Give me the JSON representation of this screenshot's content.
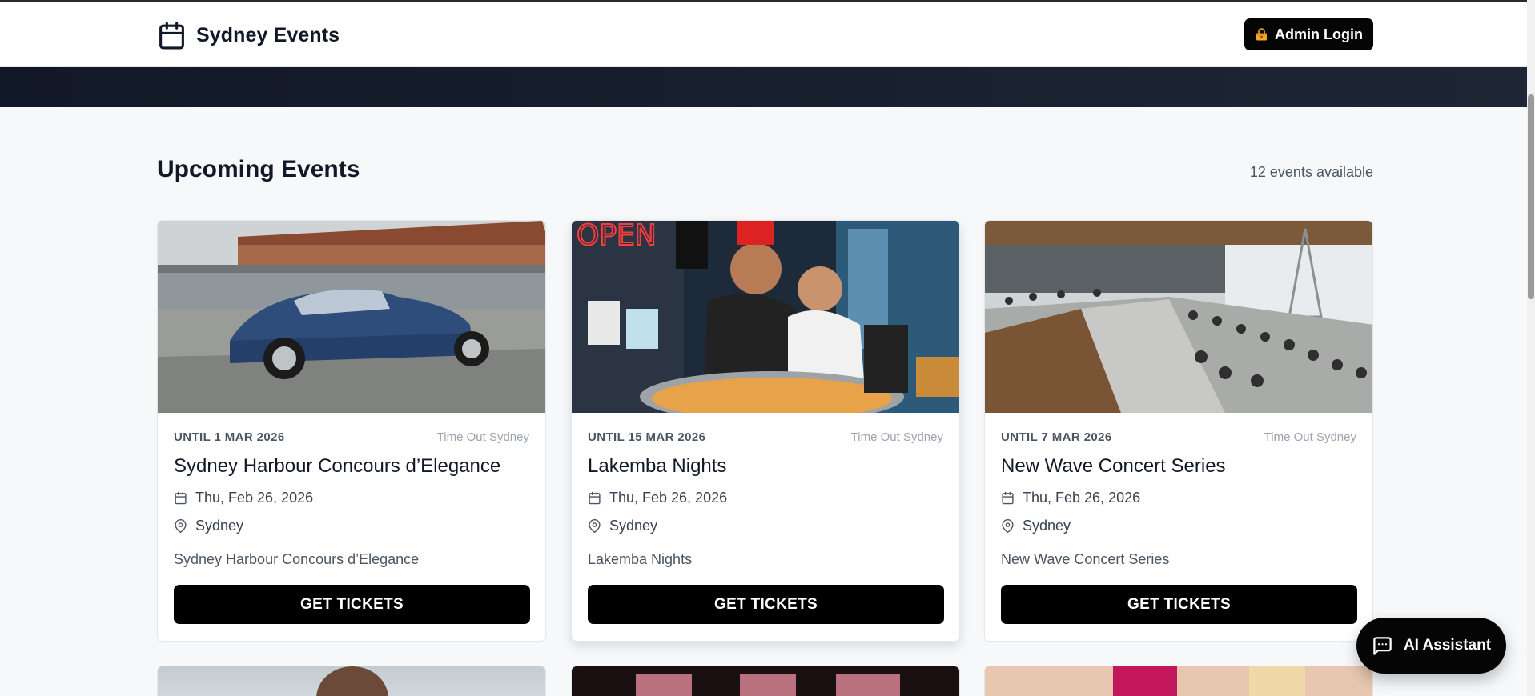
{
  "header": {
    "brand_name": "Sydney Events",
    "brand_icon": "calendar-icon",
    "admin_label": "Admin Login",
    "admin_icon": "lock-icon"
  },
  "section": {
    "title": "Upcoming Events",
    "count_text": "12 events available"
  },
  "events": [
    {
      "until": "UNTIL 1 MAR 2026",
      "source": "Time Out Sydney",
      "title": "Sydney Harbour Concours d’Elegance",
      "date": "Thu, Feb 26, 2026",
      "location": "Sydney",
      "description": "Sydney Harbour Concours d’Elegance",
      "cta": "GET TICKETS",
      "image": "classic-blue-car-photo"
    },
    {
      "until": "UNTIL 15 MAR 2026",
      "source": "Time Out Sydney",
      "title": "Lakemba Nights",
      "date": "Thu, Feb 26, 2026",
      "location": "Sydney",
      "description": "Lakemba Nights",
      "cta": "GET TICKETS",
      "image": "street-food-vendors-photo"
    },
    {
      "until": "UNTIL 7 MAR 2026",
      "source": "Time Out Sydney",
      "title": "New Wave Concert Series",
      "date": "Thu, Feb 26, 2026",
      "location": "Sydney",
      "description": "New Wave Concert Series",
      "cta": "GET TICKETS",
      "image": "waterfront-crowd-photo"
    }
  ],
  "ai_assistant": {
    "label": "AI Assistant",
    "icon": "chat-icon"
  },
  "colors": {
    "accent": "#050505",
    "banner": "#111827",
    "page_bg": "#f7f8fa"
  }
}
